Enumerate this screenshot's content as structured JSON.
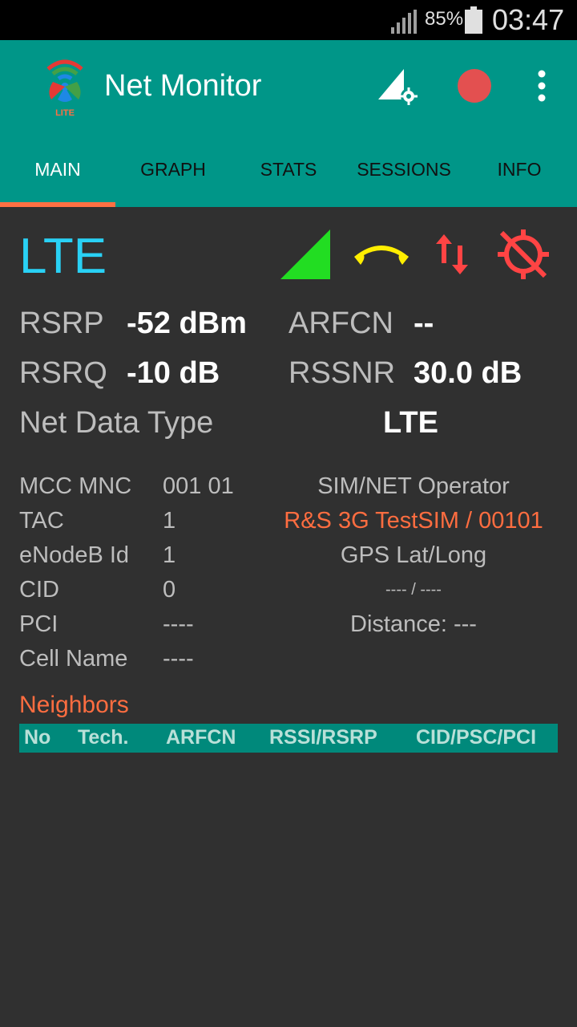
{
  "status_bar": {
    "battery_pct": "85%",
    "time": "03:47"
  },
  "app": {
    "title": "Net Monitor",
    "logo_badge": "LITE",
    "actions": [
      "network-settings-icon",
      "record-icon",
      "more-vert-icon"
    ]
  },
  "tabs": [
    {
      "label": "MAIN",
      "active": true
    },
    {
      "label": "GRAPH",
      "active": false
    },
    {
      "label": "STATS",
      "active": false
    },
    {
      "label": "SESSIONS",
      "active": false
    },
    {
      "label": "INFO",
      "active": false
    }
  ],
  "colors": {
    "primary": "#009688",
    "accent": "#ff7043",
    "tech": "#29d1f5",
    "signal": "#22dd22",
    "call": "#ffee00",
    "alert": "#ff4444"
  },
  "main": {
    "tech": "LTE",
    "rsrp_label": "RSRP",
    "rsrp_value": "-52 dBm",
    "arfcn_label": "ARFCN",
    "arfcn_value": "--",
    "rsrq_label": "RSRQ",
    "rsrq_value": "-10 dB",
    "rssnr_label": "RSSNR",
    "rssnr_value": "30.0 dB",
    "net_data_type_label": "Net Data Type",
    "net_data_type_value": "LTE"
  },
  "cell": {
    "mcc_mnc_label": "MCC MNC",
    "mcc_mnc_value": "001 01",
    "tac_label": "TAC",
    "tac_value": "1",
    "enodeb_label": "eNodeB Id",
    "enodeb_value": "1",
    "cid_label": "CID",
    "cid_value": "0",
    "pci_label": "PCI",
    "pci_value": "----",
    "cell_name_label": "Cell Name",
    "cell_name_value": "----",
    "operator_label": "SIM/NET Operator",
    "operator_value": "R&S 3G TestSIM / 00101",
    "gps_label": "GPS Lat/Long",
    "gps_value": "---- / ----",
    "distance": "Distance: ---"
  },
  "neighbors": {
    "title": "Neighbors",
    "columns": [
      "No",
      "Tech.",
      "ARFCN",
      "RSSI/RSRP",
      "CID/PSC/PCI"
    ]
  }
}
